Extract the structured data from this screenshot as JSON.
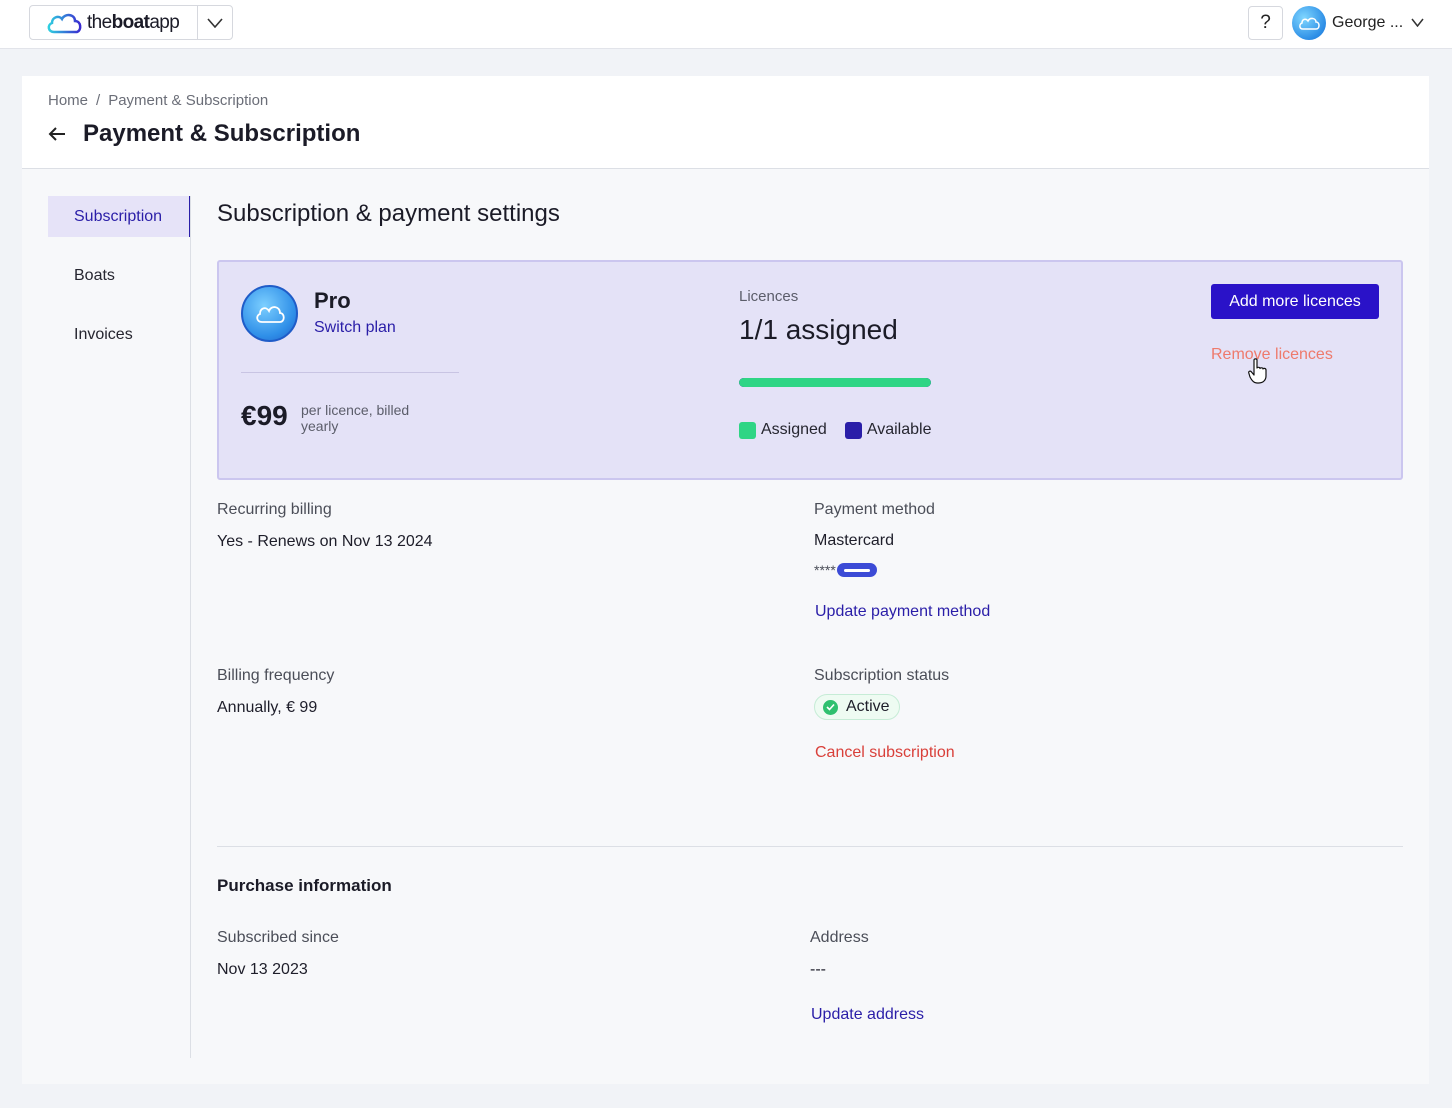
{
  "topbar": {
    "logo_text_light": "the",
    "logo_text_bold": "boat",
    "logo_text_rest": "app",
    "help_label": "?",
    "user_name": "George ..."
  },
  "breadcrumb": [
    "Home",
    "/",
    "Payment & Subscription"
  ],
  "page_title": "Payment & Subscription",
  "sidebar": {
    "items": [
      {
        "label": "Subscription",
        "active": true
      },
      {
        "label": "Boats",
        "active": false
      },
      {
        "label": "Invoices",
        "active": false
      }
    ]
  },
  "main": {
    "title": "Subscription & payment settings",
    "plan": {
      "name": "Pro",
      "switch_label": "Switch plan",
      "price": "€99",
      "price_note": "per licence, billed yearly"
    },
    "licences": {
      "label": "Licences",
      "value": "1/1 assigned",
      "assigned_fraction": 1.0,
      "legend_assigned": "Assigned",
      "legend_available": "Available",
      "assigned_color": "#2fd585",
      "available_color": "#2a1ea8"
    },
    "add_button": "Add more licences",
    "remove_link": "Remove licences",
    "recurring_billing": {
      "label": "Recurring billing",
      "value": "Yes - Renews on Nov 13 2024"
    },
    "payment_method": {
      "label": "Payment method",
      "value": "Mastercard",
      "masked": "****",
      "update_link": "Update payment method"
    },
    "billing_frequency": {
      "label": "Billing frequency",
      "value": "Annually, € 99"
    },
    "subscription_status": {
      "label": "Subscription status",
      "value": "Active",
      "cancel_link": "Cancel subscription"
    },
    "purchase": {
      "title": "Purchase information",
      "subscribed_since_label": "Subscribed since",
      "subscribed_since_value": "Nov 13 2023",
      "address_label": "Address",
      "address_value": "---",
      "update_address_link": "Update address"
    }
  }
}
